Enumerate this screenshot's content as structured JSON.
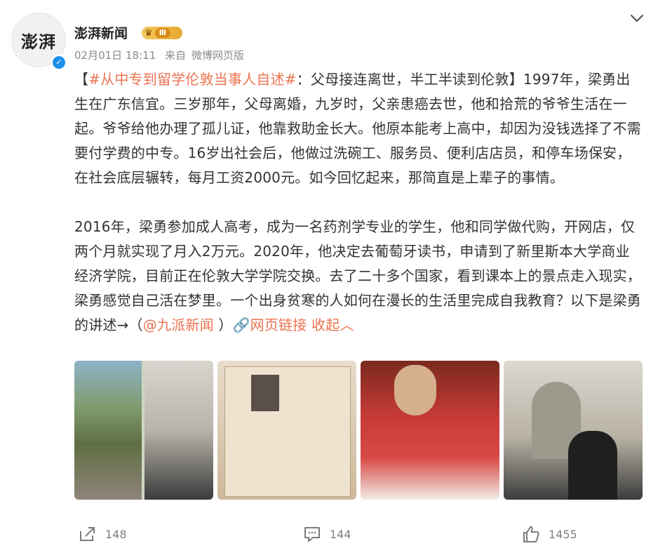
{
  "post": {
    "avatar_text": "澎湃",
    "author": "澎湃新闻",
    "level_badge": "Ⅲ",
    "date": "02月01日 18:11",
    "source_prefix": "来自",
    "source": "微博网页版",
    "body": {
      "bracket_open": "【",
      "hashtag": "#从中专到留学伦敦当事人自述#",
      "p1_rest": "：父母接连离世，半工半读到伦敦】1997年，梁勇出生在广东信宜。三岁那年，父母离婚，九岁时，父亲患癌去世，他和拾荒的爷爷生活在一起。爷爷给他办理了孤儿证，他靠救助金长大。他原本能考上高中，却因为没钱选择了不需要付学费的中专。16岁出社会后，他做过洗碗工、服务员、便利店店员，和停车场保安，在社会底层辗转，每月工资2000元。如今回忆起来，那简直是上辈子的事情。",
      "p2_text": "2016年，梁勇参加成人高考，成为一名药剂学专业的学生，他和同学做代购，开网店，仅两个月就实现了月入2万元。2020年，他决定去葡萄牙读书，申请到了新里斯本大学商业经济学院，目前正在伦敦大学学院交换。去了二十多个国家，看到课本上的景点走入现实，梁勇感觉自己活在梦里。一个出身贫寒的人如何在漫长的生活里完成自我教育？以下是梁勇的讲述→（",
      "mention": "@九派新闻",
      "mention_close": " ）",
      "link_icon": "🔗",
      "web_link": "网页链接",
      "collapse": "收起"
    }
  },
  "actions": {
    "repost_count": "148",
    "comment_count": "144",
    "like_count": "1455"
  },
  "colors": {
    "accent": "#eb7350",
    "verified": "#1d8fe8",
    "muted": "#8a8a8a"
  }
}
